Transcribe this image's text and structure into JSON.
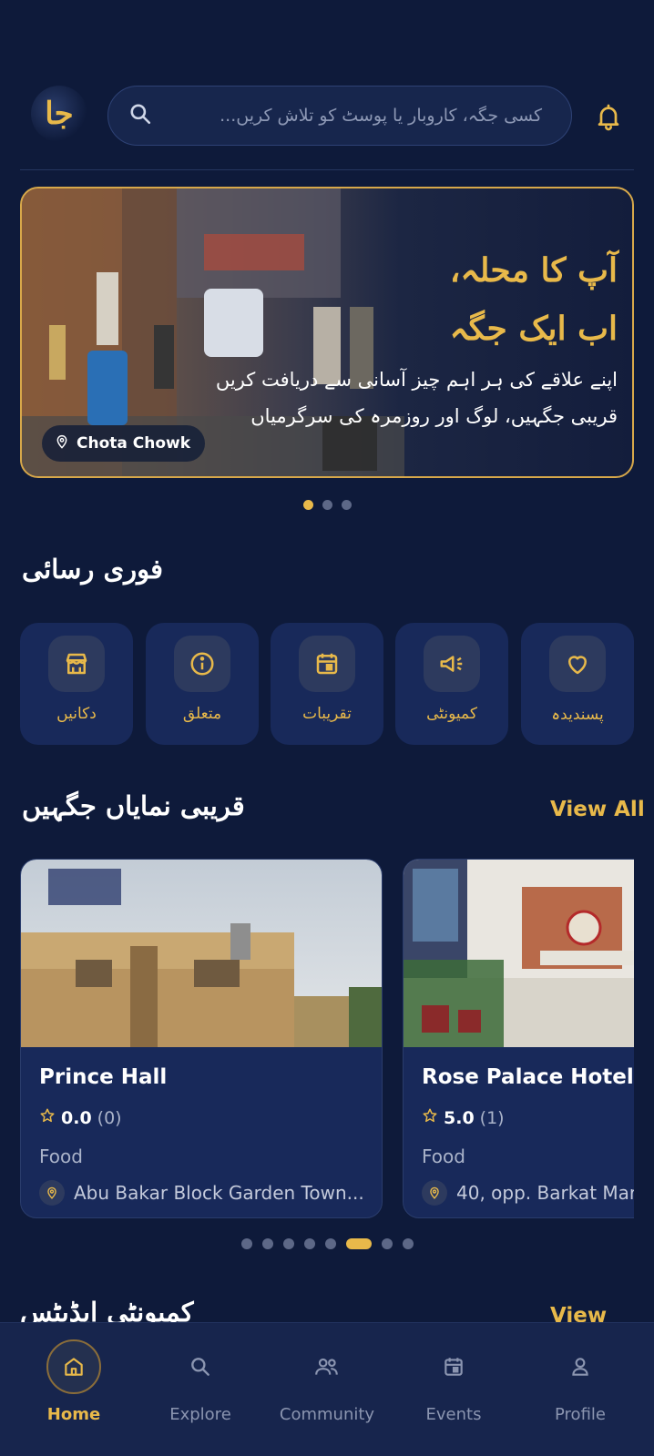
{
  "header": {
    "logo_text": "جا",
    "search_placeholder": "کسی جگہ، کاروبار یا پوسٹ کو تلاش کریں..."
  },
  "hero": {
    "title_line1": "آپ کا محلہ،",
    "title_line2": "اب ایک جگہ",
    "subtitle_line1": "اپنے علاقے کی ہر اہم چیز آسانی سے دریافت کریں",
    "subtitle_line2": "قریبی جگہیں، لوگ اور روزمرہ کی سرگرمیاں",
    "location": "Chota Chowk",
    "slides": 3,
    "active_slide": 1
  },
  "quick_access": {
    "title": "فوری رسائی",
    "items": [
      {
        "label": "پسندیدہ",
        "icon": "heart-icon"
      },
      {
        "label": "کمیونٹی",
        "icon": "megaphone-icon"
      },
      {
        "label": "تقریبات",
        "icon": "calendar-icon"
      },
      {
        "label": "متعلق",
        "icon": "info-icon"
      },
      {
        "label": "دکانیں",
        "icon": "store-icon"
      }
    ]
  },
  "nearby": {
    "title": "قریبی نمایاں جگہیں",
    "view_all": "View All",
    "places": [
      {
        "name": "Prince Hall",
        "rating": "0.0",
        "count": "(0)",
        "category": "Food",
        "address": "Abu Bakar Block Garden Town..."
      },
      {
        "name": "Rose Palace Hotel",
        "rating": "5.0",
        "count": "(1)",
        "category": "Food",
        "address": "40, opp. Barkat Mar"
      }
    ],
    "pager_count": 8,
    "pager_active": 6
  },
  "community": {
    "title": "کمیونٹی اپڈیٹس",
    "view_all": "View All"
  },
  "bottom_nav": {
    "items": [
      {
        "label": "Home",
        "icon": "home-icon",
        "active": true
      },
      {
        "label": "Explore",
        "icon": "search-icon",
        "active": false
      },
      {
        "label": "Community",
        "icon": "users-icon",
        "active": false
      },
      {
        "label": "Events",
        "icon": "calendar-icon",
        "active": false
      },
      {
        "label": "Profile",
        "icon": "user-icon",
        "active": false
      }
    ]
  },
  "colors": {
    "background": "#0e1a3a",
    "card": "#18295a",
    "accent": "#e8b94a",
    "muted": "#8b95b0"
  }
}
